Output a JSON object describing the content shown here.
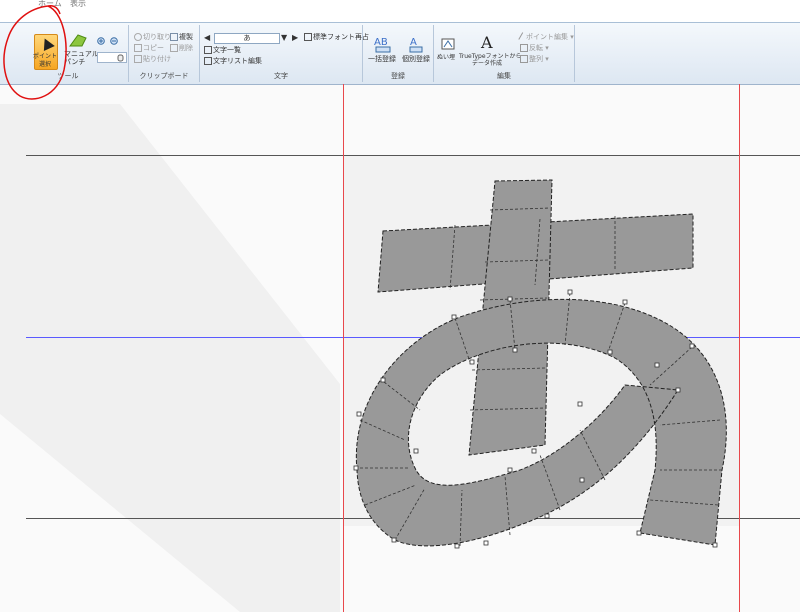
{
  "tabs": {
    "home": "ホーム",
    "view": "表示"
  },
  "ribbon": {
    "tool": {
      "select_label_1": "ポイント",
      "select_label_2": "選択",
      "manual_label_1": "マニュアル",
      "manual_label_2": "パンチ",
      "group_label": "ツール"
    },
    "clipboard": {
      "cut": "切り取り",
      "duplicate": "複製",
      "copy": "コピー",
      "delete": "削除",
      "paste": "貼り付け",
      "group_label": "クリップボード"
    },
    "character": {
      "current_char": "あ",
      "standard_font": "標準フォント再占",
      "char_list": "文字一覧",
      "char_list_edit": "文字リスト編集",
      "group_label": "文字"
    },
    "register": {
      "batch_register": "一括登録",
      "single_register": "個別登録",
      "group_label": "登録"
    },
    "edit": {
      "fill": "ぬい埋",
      "truetype_line1": "TrueTypeフォントから",
      "truetype_line2": "データ作成",
      "point_edit": "ポイント編集",
      "reverse": "反転",
      "align": "整列",
      "group_label": "編集"
    }
  },
  "colors": {
    "guide_red": "#e8484c",
    "baseline_blue": "#5a5aff",
    "guide_gray": "#555555",
    "glyph_fill": "#999999",
    "annotation_red": "#e01010",
    "selected_button": "#f6a623"
  },
  "icons": [
    "select-cursor-icon",
    "manual-punch-icon",
    "zoom-in-icon",
    "zoom-out-icon",
    "hand-icon",
    "cut-icon",
    "copy-icon",
    "paste-icon",
    "delete-icon",
    "duplicate-icon",
    "prev-char-icon",
    "next-char-icon",
    "dropdown-icon",
    "char-list-icon",
    "standard-font-icon",
    "batch-register-icon",
    "single-register-icon",
    "fill-icon",
    "truetype-icon",
    "point-edit-icon",
    "reverse-icon",
    "align-icon"
  ]
}
